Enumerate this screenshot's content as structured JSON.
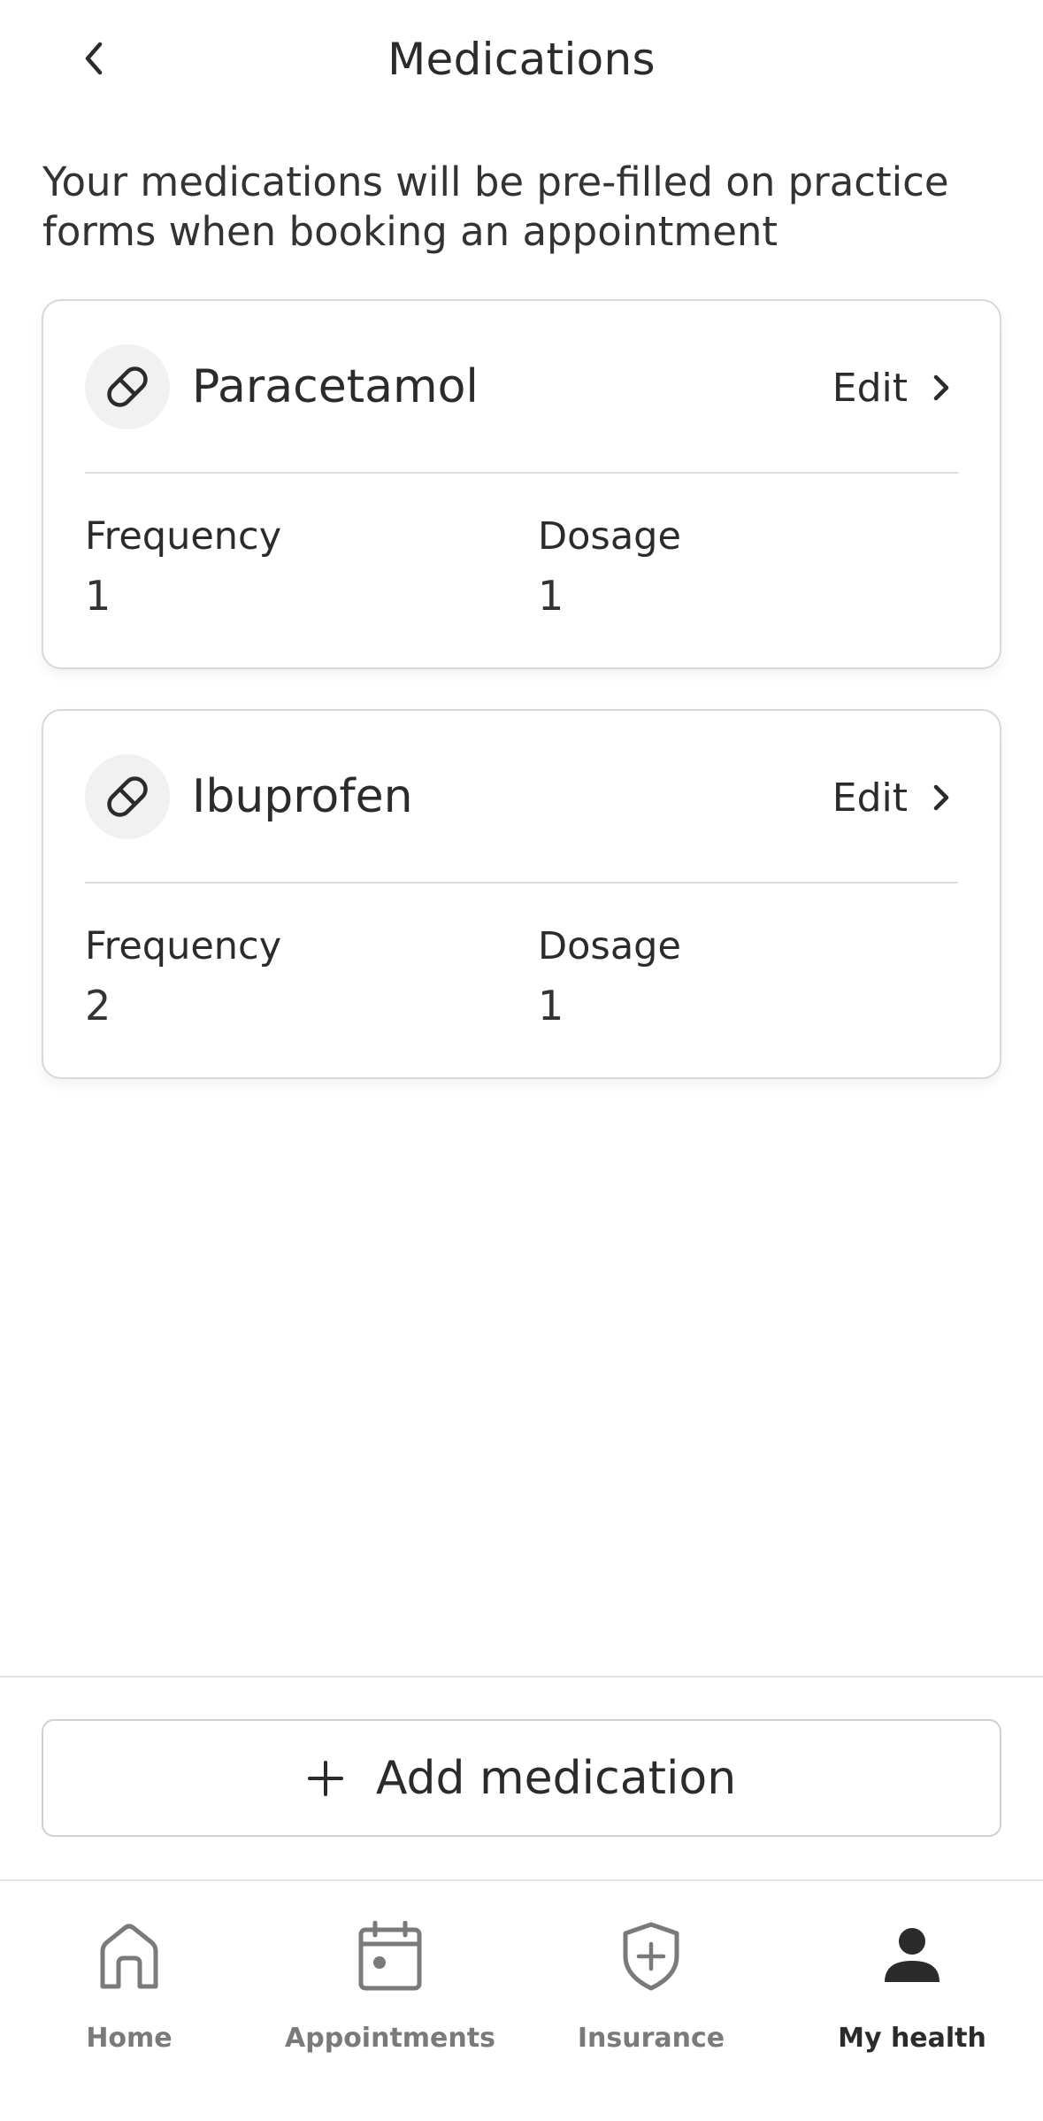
{
  "header": {
    "title": "Medications",
    "back_icon": "chevron-left-icon"
  },
  "intro_text": "Your medications will be pre-filled on practice forms when booking an appointment",
  "medications": [
    {
      "name": "Paracetamol",
      "icon": "pill-icon",
      "edit_label": "Edit",
      "frequency_label": "Frequency",
      "frequency_value": "1",
      "dosage_label": "Dosage",
      "dosage_value": "1"
    },
    {
      "name": "Ibuprofen",
      "icon": "pill-icon",
      "edit_label": "Edit",
      "frequency_label": "Frequency",
      "frequency_value": "2",
      "dosage_label": "Dosage",
      "dosage_value": "1"
    }
  ],
  "add_button": {
    "label": "Add medication",
    "icon": "plus-icon"
  },
  "tabbar": {
    "items": [
      {
        "label": "Home",
        "icon": "home-icon",
        "active": false
      },
      {
        "label": "Appointments",
        "icon": "calendar-icon",
        "active": false
      },
      {
        "label": "Insurance",
        "icon": "shield-plus-icon",
        "active": false
      },
      {
        "label": "My health",
        "icon": "person-icon",
        "active": true
      }
    ]
  },
  "colors": {
    "text": "#2b2b2b",
    "muted": "#7a7a7a",
    "border": "#d8d8d8",
    "icon_bg": "#f1f1f1"
  }
}
